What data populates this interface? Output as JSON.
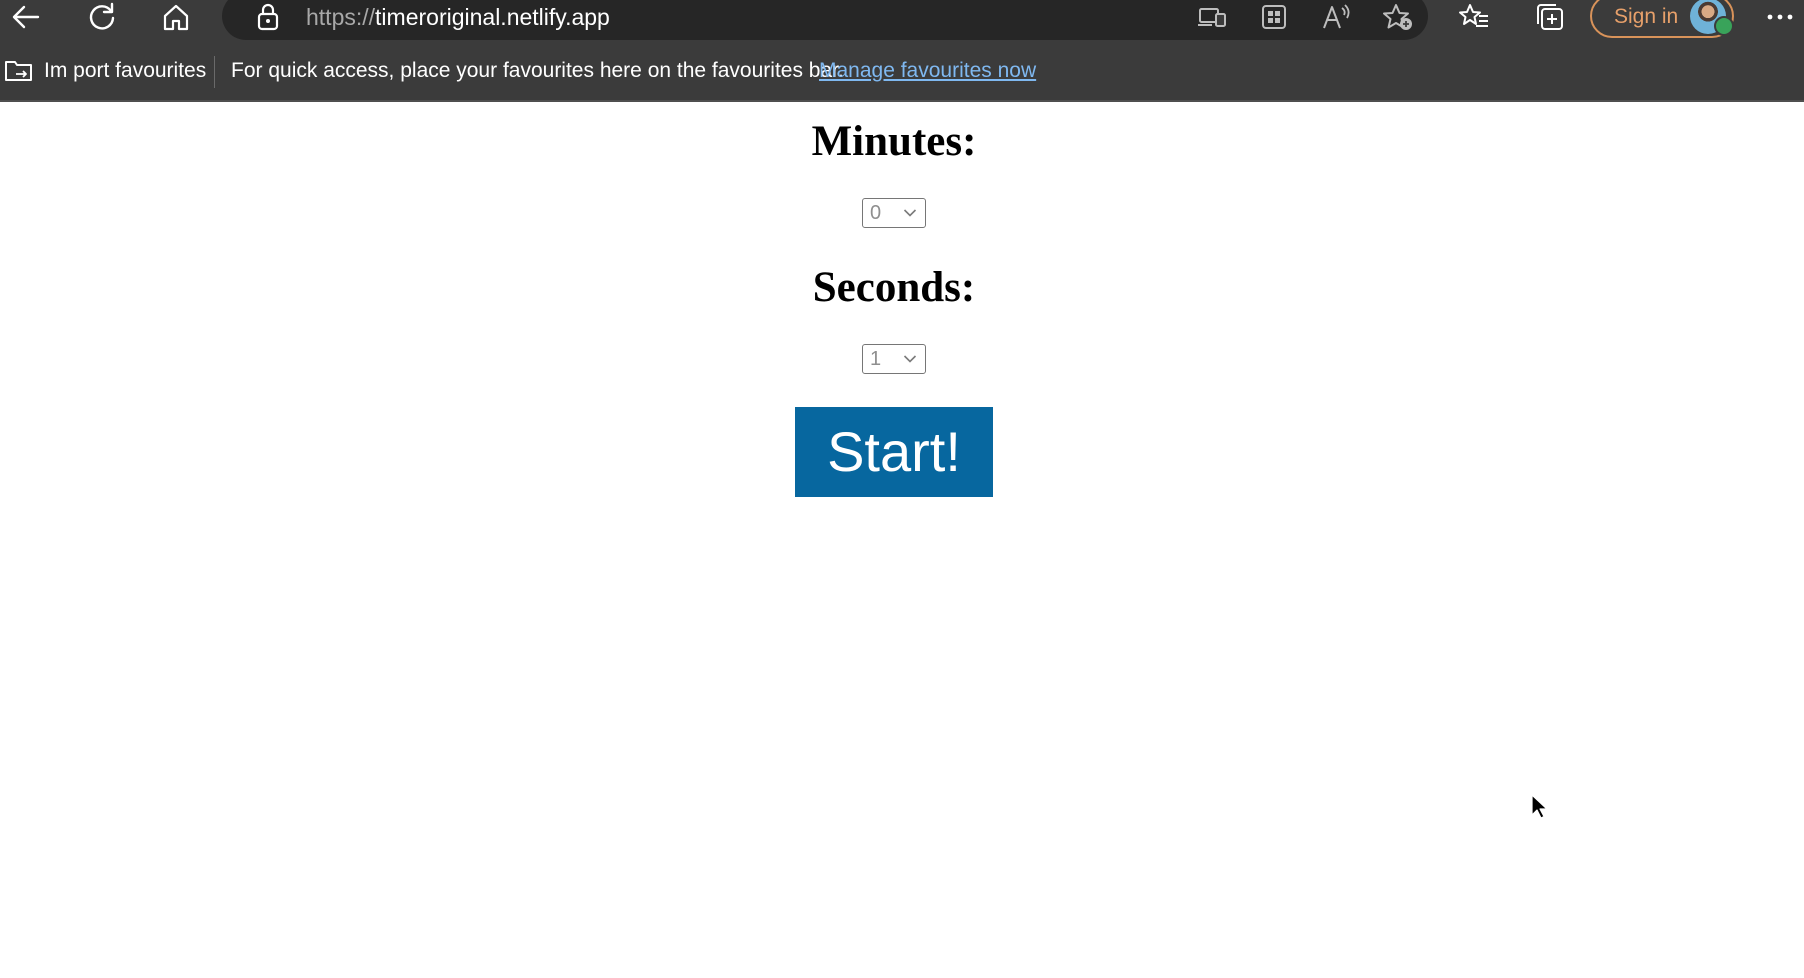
{
  "browser": {
    "url_protocol": "https://",
    "url_host": "timeroriginal.netlify.app",
    "signin_label": "Sign in",
    "icons": [
      "back-arrow-icon",
      "refresh-icon",
      "home-icon",
      "lock-icon",
      "device-icon",
      "apps-icon",
      "read-aloud-icon",
      "add-favourite-icon",
      "favourites-icon",
      "collections-icon",
      "more-icon"
    ]
  },
  "favourites_bar": {
    "import_label": "Im port favourites",
    "message": "For quick access, place your favourites here on the favourites bar.",
    "manage_link": "Manage favourites now"
  },
  "timer": {
    "minutes_label": "Minutes:",
    "minutes_value": "0",
    "seconds_label": "Seconds:",
    "seconds_value": "1",
    "start_label": "Start!"
  },
  "colors": {
    "chrome_bg": "#3b3b3b",
    "address_bg": "#262626",
    "link": "#7fb8f0",
    "signin_accent": "#e7a06a",
    "start_button": "#07679f"
  }
}
